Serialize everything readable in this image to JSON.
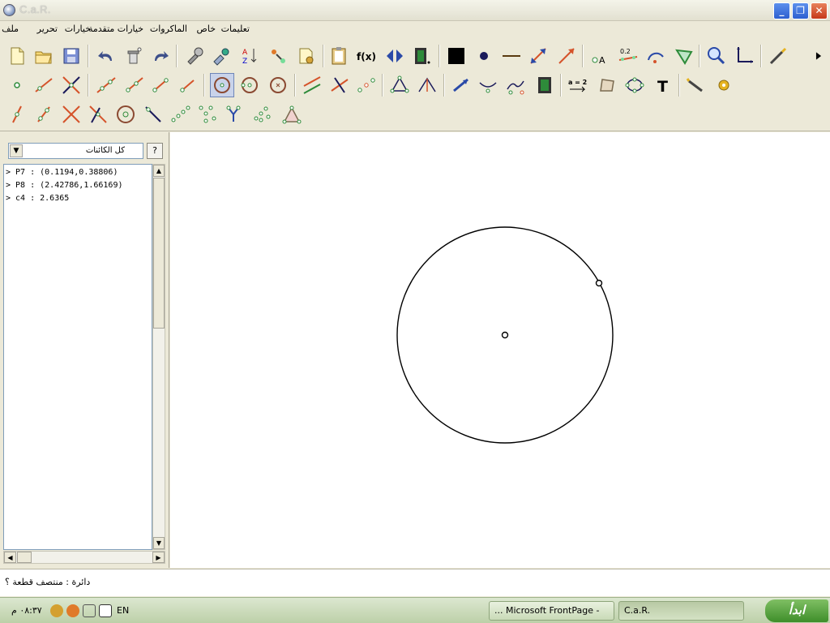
{
  "window": {
    "title": "C.a.R."
  },
  "menu": {
    "items": [
      "ملف",
      "تحرير",
      "خيارات",
      "خيارات متقدمة",
      "الماكروات",
      "خاص",
      "تعليمات"
    ]
  },
  "filter": {
    "selected": "كل الكائنات",
    "help_label": "?"
  },
  "objects": [
    "> P7 : (0.1194,0.38806)",
    "> P8 : (2.42786,1.66169)",
    "> c4 : 2.6365"
  ],
  "status": {
    "text": "دائرة : منتصف قطعة ؟"
  },
  "taskbar": {
    "clock": "٠٨:٣٧ م",
    "lang": "EN",
    "tasks": [
      {
        "label": "... Microsoft FrontPage -"
      },
      {
        "label": "C.a.R."
      }
    ],
    "start_label": "ابدأ"
  },
  "toolbar_labels": {
    "fx": "f(x)",
    "point_label": "A",
    "value_label": "0.2",
    "expr_label": "a = 2",
    "text_tool": "T"
  },
  "colors": {
    "canvas_bg": "#ffffff",
    "ui_bg": "#ece9d8"
  }
}
